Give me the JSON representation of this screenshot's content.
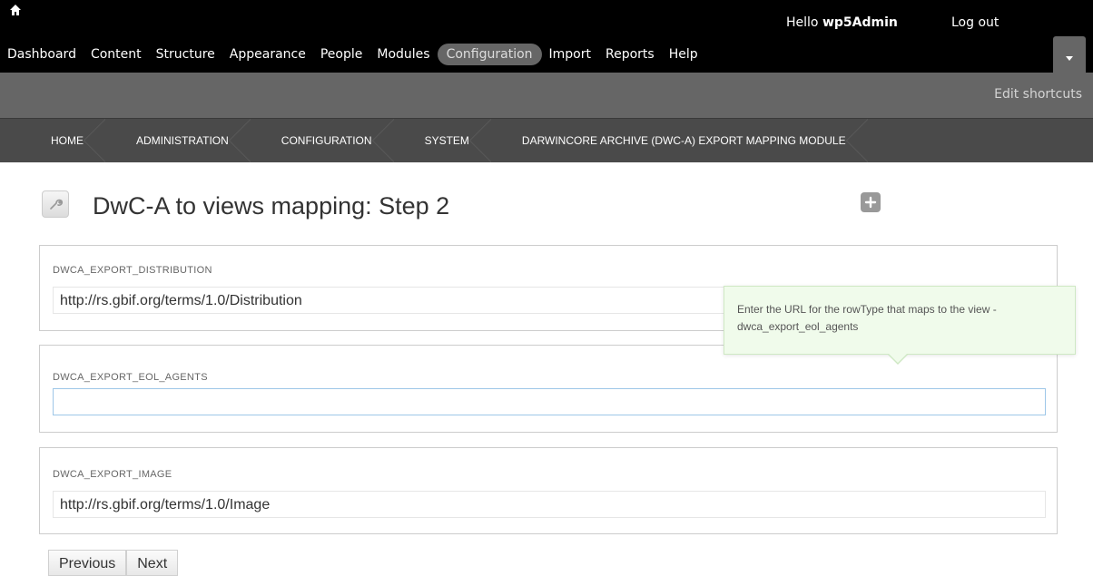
{
  "toolbar": {
    "home_icon": "home-icon",
    "greeting": "Hello ",
    "username": "wp5Admin",
    "logout": "Log out",
    "menu": [
      {
        "label": "Dashboard"
      },
      {
        "label": "Content"
      },
      {
        "label": "Structure"
      },
      {
        "label": "Appearance"
      },
      {
        "label": "People"
      },
      {
        "label": "Modules"
      },
      {
        "label": "Configuration"
      },
      {
        "label": "Import"
      },
      {
        "label": "Reports"
      },
      {
        "label": "Help"
      }
    ],
    "active_item": "Configuration",
    "drawer_toggle_icon": "chevron-down-icon"
  },
  "shortcuts": {
    "edit_label": "Edit shortcuts"
  },
  "breadcrumb": [
    "HOME",
    "ADMINISTRATION",
    "CONFIGURATION",
    "SYSTEM",
    "DARWINCORE ARCHIVE (DWC-A) EXPORT MAPPING MODULE"
  ],
  "page": {
    "title": "DwC-A to views mapping: Step 2",
    "title_icon": "wrench-icon",
    "add_shortcut_icon": "plus-icon"
  },
  "fields": {
    "distribution": {
      "label": "DWCA_EXPORT_DISTRIBUTION",
      "value": "http://rs.gbif.org/terms/1.0/Distribution"
    },
    "eol_agents": {
      "label": "DWCA_EXPORT_EOL_AGENTS",
      "value": ""
    },
    "image": {
      "label": "DWCA_EXPORT_IMAGE",
      "value": "http://rs.gbif.org/terms/1.0/Image"
    }
  },
  "tooltip": {
    "text": "Enter the URL for the rowType that maps to the view - dwca_export_eol_agents"
  },
  "buttons": {
    "previous": "Previous",
    "next": "Next"
  },
  "colors": {
    "toolbar_bg": "#000000",
    "shortcut_bg": "#666666",
    "breadcrumb_bg": "#4a4a4a",
    "tooltip_bg": "#f0fbeb"
  }
}
